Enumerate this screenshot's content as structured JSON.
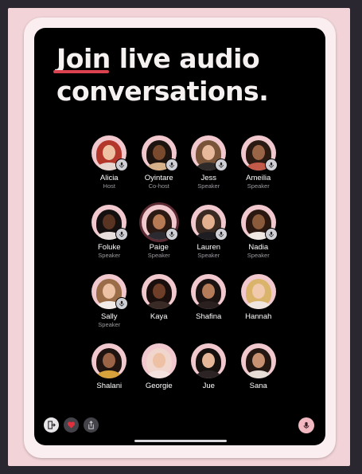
{
  "headline": {
    "highlight": "Join",
    "line1_rest": " live audio",
    "line2": "conversations."
  },
  "colors": {
    "accent_underline": "#d9424e",
    "avatar_bg": "#f1c8ce",
    "screen_bg": "#000000",
    "mic_button": "#f2b8c2"
  },
  "participants": [
    {
      "name": "Alicia",
      "role": "Host",
      "mic": true,
      "hair": "#b3372b",
      "skin": "#f0c2a4",
      "top": "#e6d6cf"
    },
    {
      "name": "Oyintare",
      "role": "Co-host",
      "mic": true,
      "hair": "#1e140f",
      "skin": "#7a4a2f",
      "top": "#d6b18a"
    },
    {
      "name": "Jess",
      "role": "Speaker",
      "mic": true,
      "hair": "#7a5438",
      "skin": "#e8b99a",
      "top": "#2e2a2a"
    },
    {
      "name": "Ameilia",
      "role": "Speaker",
      "mic": true,
      "hair": "#2a1a12",
      "skin": "#9a6446",
      "top": "#c25a4a"
    },
    {
      "name": "Foluke",
      "role": "Speaker",
      "mic": true,
      "hair": "#151010",
      "skin": "#5a3422",
      "top": "#e8e0dc"
    },
    {
      "name": "Paige",
      "role": "Speaker",
      "mic": true,
      "ring": true,
      "hair": "#2b1a14",
      "skin": "#b67a55",
      "top": "#2a2a30"
    },
    {
      "name": "Lauren",
      "role": "Speaker",
      "mic": true,
      "hair": "#3a2a22",
      "skin": "#e3b090",
      "top": "#1e1e22"
    },
    {
      "name": "Nadia",
      "role": "Speaker",
      "mic": true,
      "hair": "#2a1810",
      "skin": "#8a5a3c",
      "top": "#efe7e2"
    },
    {
      "name": "Sally",
      "role": "Speaker",
      "mic": true,
      "hair": "#9a6d48",
      "skin": "#edc1a3",
      "top": "#f3ece8"
    },
    {
      "name": "Kaya",
      "role": "",
      "mic": false,
      "hair": "#1a0f0c",
      "skin": "#6e3e28",
      "top": "#3a2a26"
    },
    {
      "name": "Shafina",
      "role": "",
      "mic": false,
      "hair": "#1b1212",
      "skin": "#b57c5a",
      "top": "#2a2020"
    },
    {
      "name": "Hannah",
      "role": "",
      "mic": false,
      "hair": "#d9b46a",
      "skin": "#f1c9ad",
      "top": "#efe6df"
    },
    {
      "name": "Shalani",
      "role": "",
      "mic": false,
      "hair": "#1f1410",
      "skin": "#9c6447",
      "top": "#d8a23a"
    },
    {
      "name": "Georgie",
      "role": "",
      "mic": false,
      "hair": "#f0d6cc",
      "skin": "#eec0a4",
      "top": "#f4e2de"
    },
    {
      "name": "Jue",
      "role": "",
      "mic": false,
      "hair": "#16110f",
      "skin": "#e5b697",
      "top": "#2c2424"
    },
    {
      "name": "Sana",
      "role": "",
      "mic": false,
      "hair": "#251813",
      "skin": "#c79172",
      "top": "#e7ded8"
    }
  ],
  "controls": {
    "leave_icon": "leave-icon",
    "react_icon": "heart-icon",
    "share_icon": "share-icon",
    "mic_icon": "microphone-icon"
  }
}
